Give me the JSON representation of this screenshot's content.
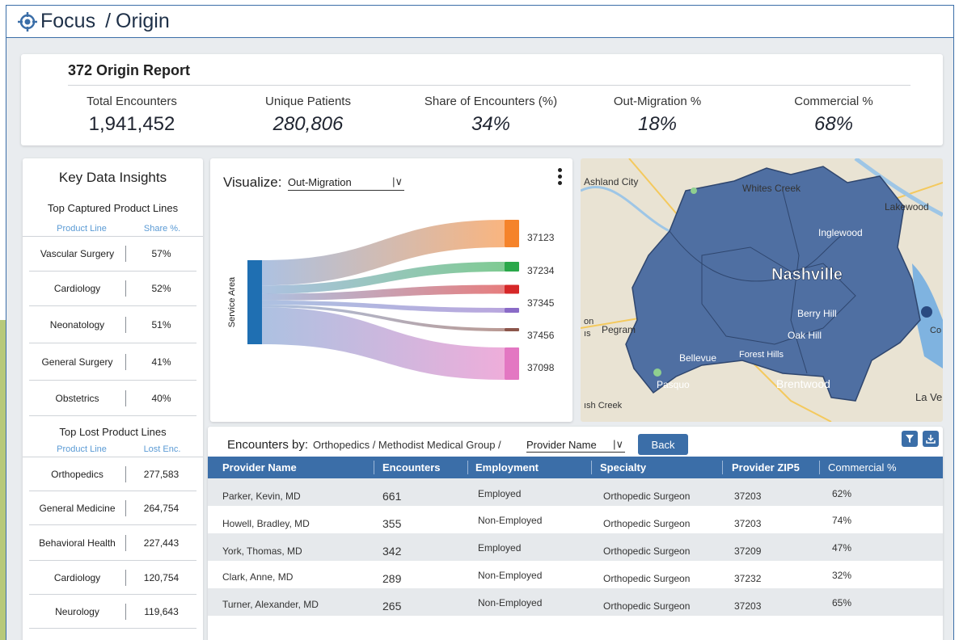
{
  "app": {
    "name": "Focus",
    "breadcrumb": "Origin"
  },
  "report": {
    "title": "372 Origin Report",
    "kpis": [
      {
        "label": "Total Encounters",
        "value": "1,941,452"
      },
      {
        "label": "Unique Patients",
        "value": "280,806"
      },
      {
        "label": "Share of Encounters (%)",
        "value": "34%"
      },
      {
        "label": "Out-Migration %",
        "value": "18%"
      },
      {
        "label": "Commercial %",
        "value": "68%"
      }
    ]
  },
  "insights": {
    "title": "Key Data Insights",
    "captured": {
      "title": "Top Captured Product Lines",
      "headers": [
        "Product Line",
        "Share %."
      ],
      "rows": [
        {
          "name": "Vascular Surgery",
          "value": "57%"
        },
        {
          "name": "Cardiology",
          "value": "52%"
        },
        {
          "name": "Neonatology",
          "value": "51%"
        },
        {
          "name": "General Surgery",
          "value": "41%"
        },
        {
          "name": "Obstetrics",
          "value": "40%"
        }
      ]
    },
    "lost": {
      "title": "Top Lost Product Lines",
      "headers": [
        "Product Line",
        "Lost Enc."
      ],
      "rows": [
        {
          "name": "Orthopedics",
          "value": "277,583"
        },
        {
          "name": "General Medicine",
          "value": "264,754"
        },
        {
          "name": "Behavioral Health",
          "value": "227,443"
        },
        {
          "name": "Cardiology",
          "value": "120,754"
        },
        {
          "name": "Neurology",
          "value": "119,643"
        }
      ]
    }
  },
  "visualize": {
    "label": "Visualize:",
    "selected": "Out-Migration",
    "source_label": "Service Area",
    "flows": [
      {
        "zip": "37123",
        "color": "#f5832a",
        "share": 0.3
      },
      {
        "zip": "37234",
        "color": "#2aa84a",
        "share": 0.1
      },
      {
        "zip": "37345",
        "color": "#d62728",
        "share": 0.08
      },
      {
        "zip": "37456",
        "color": "#8a6bc7",
        "share": 0.05
      },
      {
        "zip": "37456",
        "color": "#8c564b",
        "share": 0.03
      },
      {
        "zip": "37098",
        "color": "#e377c2",
        "share": 0.44
      }
    ],
    "zip_labels": [
      "37123",
      "37234",
      "37345",
      "37456",
      "37098"
    ]
  },
  "map": {
    "labels": [
      "Ashland City",
      "Whites Creek",
      "Lakewood",
      "Inglewood",
      "Nashville",
      "Berry Hill",
      "Oak Hill",
      "Pegram",
      "Bellevue",
      "Forest Hills",
      "Pasquo",
      "Brentwood",
      "La Ver",
      "on",
      "ıs",
      "ısh Creek",
      "Co"
    ]
  },
  "encounters": {
    "label": "Encounters by:",
    "path": "Orthopedics / Methodist Medical Group /",
    "selected": "Provider Name",
    "back_label": "Back",
    "columns": [
      "Provider Name",
      "Encounters",
      "Employment",
      "Specialty",
      "Provider ZIP5",
      "Commercial %"
    ],
    "rows": [
      {
        "name": "Parker, Kevin, MD",
        "encounters": "661",
        "employment": "Employed",
        "specialty": "Orthopedic Surgeon",
        "zip": "37203",
        "commercial": "62%"
      },
      {
        "name": "Howell, Bradley, MD",
        "encounters": "355",
        "employment": "Non-Employed",
        "specialty": "Orthopedic Surgeon",
        "zip": "37203",
        "commercial": "74%"
      },
      {
        "name": "York, Thomas, MD",
        "encounters": "342",
        "employment": "Employed",
        "specialty": "Orthopedic Surgeon",
        "zip": "37209",
        "commercial": "47%"
      },
      {
        "name": "Clark, Anne, MD",
        "encounters": "289",
        "employment": "Non-Employed",
        "specialty": "Orthopedic Surgeon",
        "zip": "37232",
        "commercial": "32%"
      },
      {
        "name": "Turner, Alexander, MD",
        "encounters": "265",
        "employment": "Non-Employed",
        "specialty": "Orthopedic Surgeon",
        "zip": "37203",
        "commercial": "65%"
      }
    ]
  },
  "colors": {
    "brand": "#3b6ea8",
    "accent_text": "#5b9bd5",
    "map_region": "#4f6fa2"
  }
}
